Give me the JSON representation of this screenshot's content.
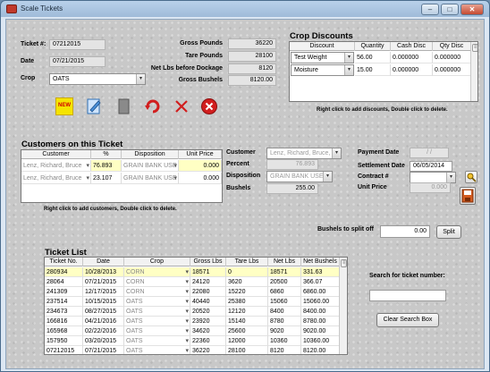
{
  "window": {
    "title": "Scale Tickets",
    "minimize": "–",
    "maximize": "□",
    "close": "✕"
  },
  "ticket": {
    "ticket_label": "Ticket #:",
    "ticket_value": "07212015",
    "date_label": "Date",
    "date_value": "07/21/2015",
    "crop_label": "Crop",
    "crop_value": "OATS"
  },
  "weights": {
    "gross_pounds_label": "Gross Pounds",
    "gross_pounds_value": "36220",
    "tare_pounds_label": "Tare Pounds",
    "tare_pounds_value": "28100",
    "net_lbs_label": "Net Lbs before Dockage",
    "net_lbs_value": "8120",
    "gross_bushels_label": "Gross Bushels",
    "gross_bushels_value": "8120.00"
  },
  "toolbar": {
    "new_label": "NEW",
    "icons": [
      "new-icon",
      "edit-icon",
      "copy-icon",
      "undo-icon",
      "cancel-x-icon",
      "delete-icon"
    ]
  },
  "crop_discounts": {
    "title": "Crop Discounts",
    "columns": [
      "Discount",
      "Quantity",
      "Cash Disc",
      "Qty Disc"
    ],
    "rows": [
      {
        "discount": "Test Weight",
        "quantity": "56.00",
        "cash_disc": "0.000000",
        "qty_disc": "0.000000"
      },
      {
        "discount": "Moisture",
        "quantity": "15.00",
        "cash_disc": "0.000000",
        "qty_disc": "0.000000"
      }
    ],
    "hint": "Right click to add discounts, Double click to delete."
  },
  "customers": {
    "title": "Customers on this Ticket",
    "columns": [
      "Customer",
      "%",
      "Disposition",
      "Unit Price"
    ],
    "rows": [
      {
        "customer": "Lenz, Richard, Bruce",
        "percent": "76.893",
        "disposition": "GRAIN BANK USE",
        "unit_price": "0.000"
      },
      {
        "customer": "Lenz, Richard, Bruce",
        "percent": "23.107",
        "disposition": "GRAIN BANK USE",
        "unit_price": "0.000"
      }
    ],
    "hint": "Right click to add customers, Double click to delete."
  },
  "customer_detail": {
    "customer_label": "Customer",
    "customer_value": "Lenz, Richard, Bruce, Chi",
    "percent_label": "Percent",
    "percent_value": "76.893",
    "disposition_label": "Disposition",
    "disposition_value": "GRAIN BANK USED",
    "bushels_label": "Bushels",
    "bushels_value": "255.00"
  },
  "payment": {
    "payment_date_label": "Payment Date",
    "payment_date_value": "/ /",
    "settlement_date_label": "Settlement Date",
    "settlement_date_value": "06/05/2014",
    "contract_label": "Contract #",
    "contract_value": "",
    "unit_price_label": "Unit Price",
    "unit_price_value": "0.000"
  },
  "split": {
    "label": "Bushels to split off",
    "value": "0.00",
    "button": "Split"
  },
  "ticket_list": {
    "title": "Ticket List",
    "columns": [
      "Ticket No.",
      "Date",
      "Crop",
      "Gross Lbs",
      "Tare Lbs",
      "Net Lbs",
      "Net Bushels"
    ],
    "rows": [
      [
        "280934",
        "10/28/2013",
        "CORN",
        "18571",
        "0",
        "18571",
        "331.63"
      ],
      [
        "28064",
        "07/21/2015",
        "CORN",
        "24120",
        "3620",
        "20500",
        "366.07"
      ],
      [
        "241309",
        "12/17/2015",
        "CORN",
        "22080",
        "15220",
        "6860",
        "6860.00"
      ],
      [
        "237514",
        "10/15/2015",
        "OATS",
        "40440",
        "25380",
        "15060",
        "15060.00"
      ],
      [
        "234673",
        "08/27/2015",
        "OATS",
        "20520",
        "12120",
        "8400",
        "8400.00"
      ],
      [
        "166816",
        "04/21/2016",
        "OATS",
        "23920",
        "15140",
        "8780",
        "8780.00"
      ],
      [
        "165968",
        "02/22/2016",
        "OATS",
        "34620",
        "25600",
        "9020",
        "9020.00"
      ],
      [
        "157950",
        "03/20/2015",
        "OATS",
        "22360",
        "12000",
        "10360",
        "10360.00"
      ],
      [
        "07212015",
        "07/21/2015",
        "OATS",
        "36220",
        "28100",
        "8120",
        "8120.00"
      ]
    ]
  },
  "search": {
    "label": "Search for ticket number:",
    "value": "",
    "clear_button": "Clear Search Box"
  }
}
